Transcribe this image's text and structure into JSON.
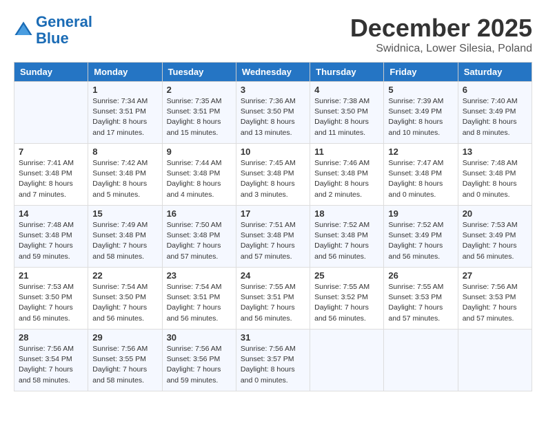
{
  "header": {
    "logo_line1": "General",
    "logo_line2": "Blue",
    "month_title": "December 2025",
    "location": "Swidnica, Lower Silesia, Poland"
  },
  "days_of_week": [
    "Sunday",
    "Monday",
    "Tuesday",
    "Wednesday",
    "Thursday",
    "Friday",
    "Saturday"
  ],
  "weeks": [
    [
      {
        "day": "",
        "info": ""
      },
      {
        "day": "1",
        "info": "Sunrise: 7:34 AM\nSunset: 3:51 PM\nDaylight: 8 hours\nand 17 minutes."
      },
      {
        "day": "2",
        "info": "Sunrise: 7:35 AM\nSunset: 3:51 PM\nDaylight: 8 hours\nand 15 minutes."
      },
      {
        "day": "3",
        "info": "Sunrise: 7:36 AM\nSunset: 3:50 PM\nDaylight: 8 hours\nand 13 minutes."
      },
      {
        "day": "4",
        "info": "Sunrise: 7:38 AM\nSunset: 3:50 PM\nDaylight: 8 hours\nand 11 minutes."
      },
      {
        "day": "5",
        "info": "Sunrise: 7:39 AM\nSunset: 3:49 PM\nDaylight: 8 hours\nand 10 minutes."
      },
      {
        "day": "6",
        "info": "Sunrise: 7:40 AM\nSunset: 3:49 PM\nDaylight: 8 hours\nand 8 minutes."
      }
    ],
    [
      {
        "day": "7",
        "info": "Sunrise: 7:41 AM\nSunset: 3:48 PM\nDaylight: 8 hours\nand 7 minutes."
      },
      {
        "day": "8",
        "info": "Sunrise: 7:42 AM\nSunset: 3:48 PM\nDaylight: 8 hours\nand 5 minutes."
      },
      {
        "day": "9",
        "info": "Sunrise: 7:44 AM\nSunset: 3:48 PM\nDaylight: 8 hours\nand 4 minutes."
      },
      {
        "day": "10",
        "info": "Sunrise: 7:45 AM\nSunset: 3:48 PM\nDaylight: 8 hours\nand 3 minutes."
      },
      {
        "day": "11",
        "info": "Sunrise: 7:46 AM\nSunset: 3:48 PM\nDaylight: 8 hours\nand 2 minutes."
      },
      {
        "day": "12",
        "info": "Sunrise: 7:47 AM\nSunset: 3:48 PM\nDaylight: 8 hours\nand 0 minutes."
      },
      {
        "day": "13",
        "info": "Sunrise: 7:48 AM\nSunset: 3:48 PM\nDaylight: 8 hours\nand 0 minutes."
      }
    ],
    [
      {
        "day": "14",
        "info": "Sunrise: 7:48 AM\nSunset: 3:48 PM\nDaylight: 7 hours\nand 59 minutes."
      },
      {
        "day": "15",
        "info": "Sunrise: 7:49 AM\nSunset: 3:48 PM\nDaylight: 7 hours\nand 58 minutes."
      },
      {
        "day": "16",
        "info": "Sunrise: 7:50 AM\nSunset: 3:48 PM\nDaylight: 7 hours\nand 57 minutes."
      },
      {
        "day": "17",
        "info": "Sunrise: 7:51 AM\nSunset: 3:48 PM\nDaylight: 7 hours\nand 57 minutes."
      },
      {
        "day": "18",
        "info": "Sunrise: 7:52 AM\nSunset: 3:48 PM\nDaylight: 7 hours\nand 56 minutes."
      },
      {
        "day": "19",
        "info": "Sunrise: 7:52 AM\nSunset: 3:49 PM\nDaylight: 7 hours\nand 56 minutes."
      },
      {
        "day": "20",
        "info": "Sunrise: 7:53 AM\nSunset: 3:49 PM\nDaylight: 7 hours\nand 56 minutes."
      }
    ],
    [
      {
        "day": "21",
        "info": "Sunrise: 7:53 AM\nSunset: 3:50 PM\nDaylight: 7 hours\nand 56 minutes."
      },
      {
        "day": "22",
        "info": "Sunrise: 7:54 AM\nSunset: 3:50 PM\nDaylight: 7 hours\nand 56 minutes."
      },
      {
        "day": "23",
        "info": "Sunrise: 7:54 AM\nSunset: 3:51 PM\nDaylight: 7 hours\nand 56 minutes."
      },
      {
        "day": "24",
        "info": "Sunrise: 7:55 AM\nSunset: 3:51 PM\nDaylight: 7 hours\nand 56 minutes."
      },
      {
        "day": "25",
        "info": "Sunrise: 7:55 AM\nSunset: 3:52 PM\nDaylight: 7 hours\nand 56 minutes."
      },
      {
        "day": "26",
        "info": "Sunrise: 7:55 AM\nSunset: 3:53 PM\nDaylight: 7 hours\nand 57 minutes."
      },
      {
        "day": "27",
        "info": "Sunrise: 7:56 AM\nSunset: 3:53 PM\nDaylight: 7 hours\nand 57 minutes."
      }
    ],
    [
      {
        "day": "28",
        "info": "Sunrise: 7:56 AM\nSunset: 3:54 PM\nDaylight: 7 hours\nand 58 minutes."
      },
      {
        "day": "29",
        "info": "Sunrise: 7:56 AM\nSunset: 3:55 PM\nDaylight: 7 hours\nand 58 minutes."
      },
      {
        "day": "30",
        "info": "Sunrise: 7:56 AM\nSunset: 3:56 PM\nDaylight: 7 hours\nand 59 minutes."
      },
      {
        "day": "31",
        "info": "Sunrise: 7:56 AM\nSunset: 3:57 PM\nDaylight: 8 hours\nand 0 minutes."
      },
      {
        "day": "",
        "info": ""
      },
      {
        "day": "",
        "info": ""
      },
      {
        "day": "",
        "info": ""
      }
    ]
  ]
}
